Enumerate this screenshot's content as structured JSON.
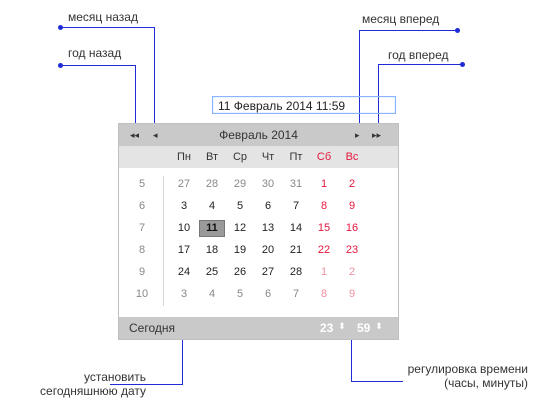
{
  "annotations": {
    "month_back": "месяц назад",
    "year_back": "год назад",
    "month_forward": "месяц вперед",
    "year_forward": "год вперед",
    "set_today": "установить сегодняшнюю дату",
    "time_adjust": "регулировка времени (часы, минуты)"
  },
  "input": {
    "value": "11 Февраль 2014 11:59"
  },
  "calendar": {
    "month_title": "Февраль 2014",
    "nav": {
      "year_back": "◂◂",
      "month_back": "◂",
      "month_forward": "▸",
      "year_forward": "▸▸"
    },
    "weekdays": [
      "Пн",
      "Вт",
      "Ср",
      "Чт",
      "Пт",
      "Сб",
      "Вс"
    ],
    "weeks": [
      {
        "num": "5",
        "days": [
          "27",
          "28",
          "29",
          "30",
          "31",
          "1",
          "2"
        ]
      },
      {
        "num": "6",
        "days": [
          "3",
          "4",
          "5",
          "6",
          "7",
          "8",
          "9"
        ]
      },
      {
        "num": "7",
        "days": [
          "10",
          "11",
          "12",
          "13",
          "14",
          "15",
          "16"
        ]
      },
      {
        "num": "8",
        "days": [
          "17",
          "18",
          "19",
          "20",
          "21",
          "22",
          "23"
        ]
      },
      {
        "num": "9",
        "days": [
          "24",
          "25",
          "26",
          "27",
          "28",
          "1",
          "2"
        ]
      },
      {
        "num": "10",
        "days": [
          "3",
          "4",
          "5",
          "6",
          "7",
          "8",
          "9"
        ]
      }
    ],
    "selected_day": "11",
    "footer": {
      "today_label": "Сегодня",
      "hours": "23",
      "minutes": "59",
      "spinner_glyph": "⬍"
    }
  },
  "colors": {
    "accent": "#1e2bd6",
    "weekend": "#e4163d",
    "header_bg": "#c9c9c9"
  }
}
